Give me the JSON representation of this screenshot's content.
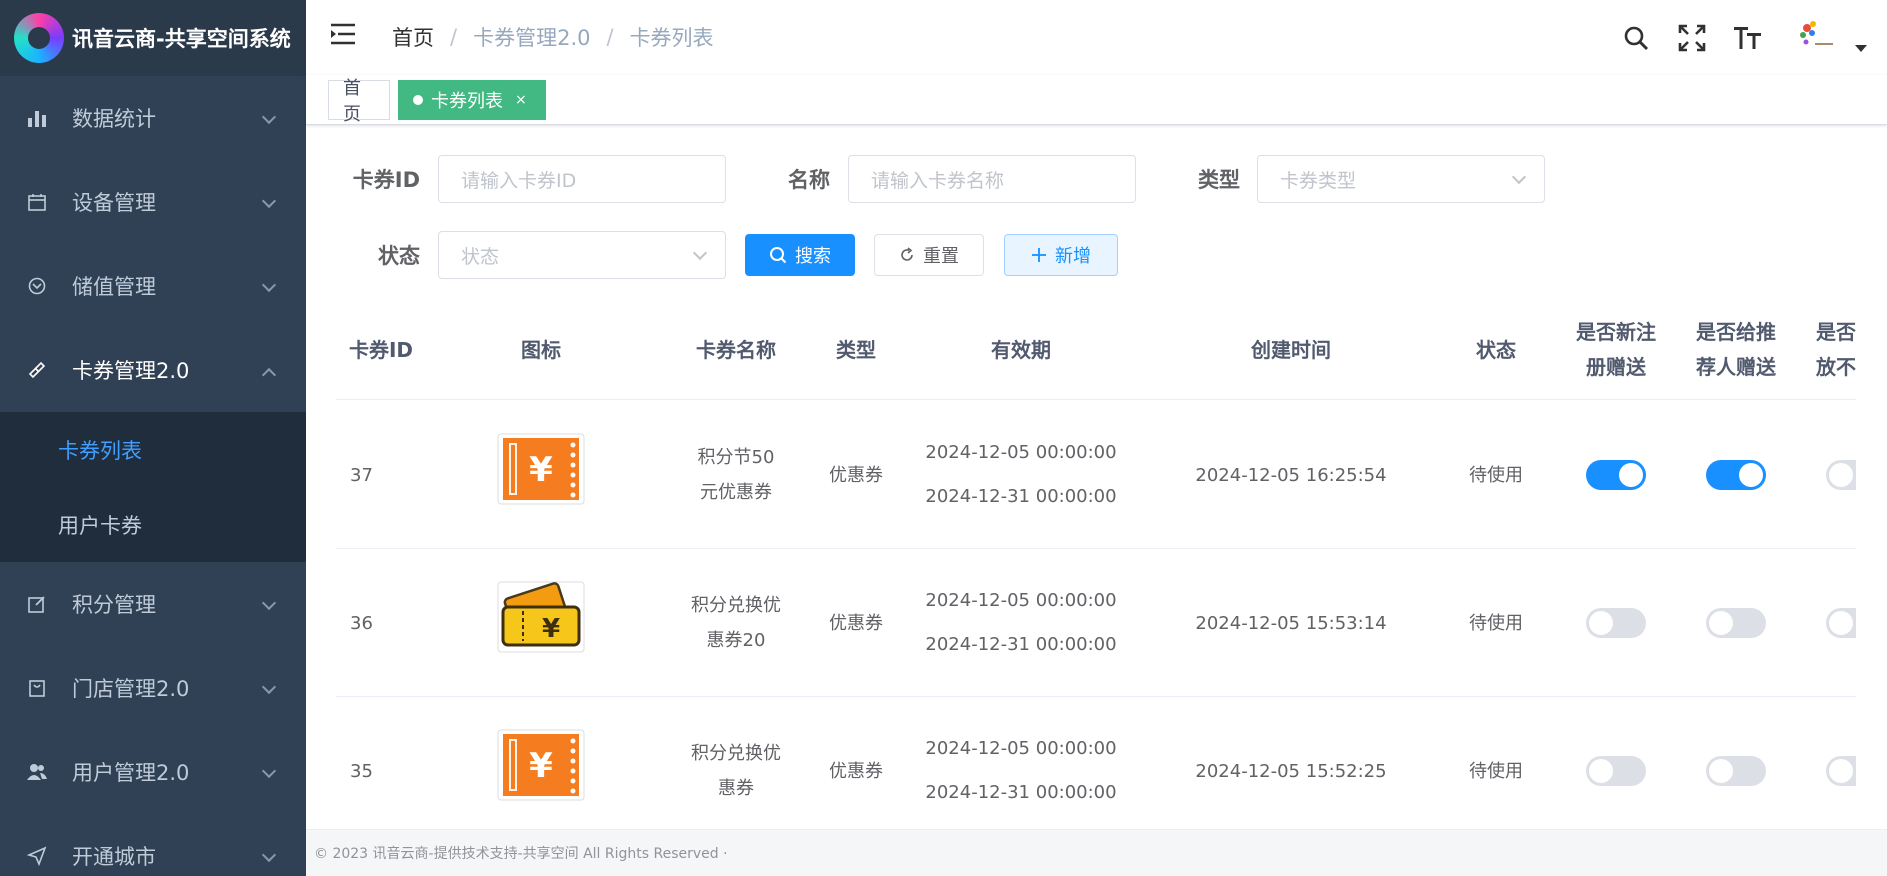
{
  "app": {
    "title": "讯音云商-共享空间系统"
  },
  "sidebar": {
    "items": [
      {
        "label": "数据统计"
      },
      {
        "label": "设备管理"
      },
      {
        "label": "储值管理"
      },
      {
        "label": "卡券管理2.0"
      },
      {
        "label": "积分管理"
      },
      {
        "label": "门店管理2.0"
      },
      {
        "label": "用户管理2.0"
      },
      {
        "label": "开通城市"
      }
    ],
    "submenu": [
      {
        "label": "卡券列表"
      },
      {
        "label": "用户卡券"
      }
    ]
  },
  "breadcrumb": {
    "home": "首页",
    "sep": "/",
    "level1": "卡券管理2.0",
    "level2": "卡券列表"
  },
  "tags": {
    "home": "首页",
    "active": "卡券列表",
    "close": "×"
  },
  "filter": {
    "id_label": "卡券ID",
    "id_placeholder": "请输入卡券ID",
    "name_label": "名称",
    "name_placeholder": "请输入卡券名称",
    "type_label": "类型",
    "type_placeholder": "卡券类型",
    "status_label": "状态",
    "status_placeholder": "状态",
    "search": "搜索",
    "reset": "重置",
    "add": "新增"
  },
  "table": {
    "headers": [
      "卡券ID",
      "图标",
      "卡券名称",
      "类型",
      "有效期",
      "创建时间",
      "状态",
      "是否新注册赠送",
      "是否给推荐人赠送",
      "是否只发放不售卖"
    ],
    "header_lines": {
      "h7a": "是否新注",
      "h7b": "册赠送",
      "h8a": "是否给推",
      "h8b": "荐人赠送",
      "h9a": "是否只发",
      "h9b": "放不售卖"
    },
    "rows": [
      {
        "id": "37",
        "icon": "ticket-orange-icon",
        "name1": "积分节50",
        "name2": "元优惠券",
        "type": "优惠券",
        "start": "2024-12-05 00:00:00",
        "end": "2024-12-31 00:00:00",
        "created": "2024-12-05 16:25:54",
        "status": "待使用",
        "new_reg": true,
        "referrer": true,
        "only_issue": false
      },
      {
        "id": "36",
        "icon": "tickets-yellow-icon",
        "name1": "积分兑换优",
        "name2": "惠券20",
        "type": "优惠券",
        "start": "2024-12-05 00:00:00",
        "end": "2024-12-31 00:00:00",
        "created": "2024-12-05 15:53:14",
        "status": "待使用",
        "new_reg": false,
        "referrer": false,
        "only_issue": false
      },
      {
        "id": "35",
        "icon": "ticket-orange-icon",
        "name1": "积分兑换优",
        "name2": "惠券",
        "type": "优惠券",
        "start": "2024-12-05 00:00:00",
        "end": "2024-12-31 00:00:00",
        "created": "2024-12-05 15:52:25",
        "status": "待使用",
        "new_reg": false,
        "referrer": false,
        "only_issue": false
      }
    ]
  },
  "footer": {
    "text": "© 2023 讯音云商-提供技术支持-共享空间 All Rights Reserved ·"
  },
  "colors": {
    "sidebar": "#304156",
    "primary": "#1890ff",
    "tag_active": "#42b983",
    "coupon_orange": "#f57c1f",
    "coupon_yellow": "#f7c61a"
  }
}
